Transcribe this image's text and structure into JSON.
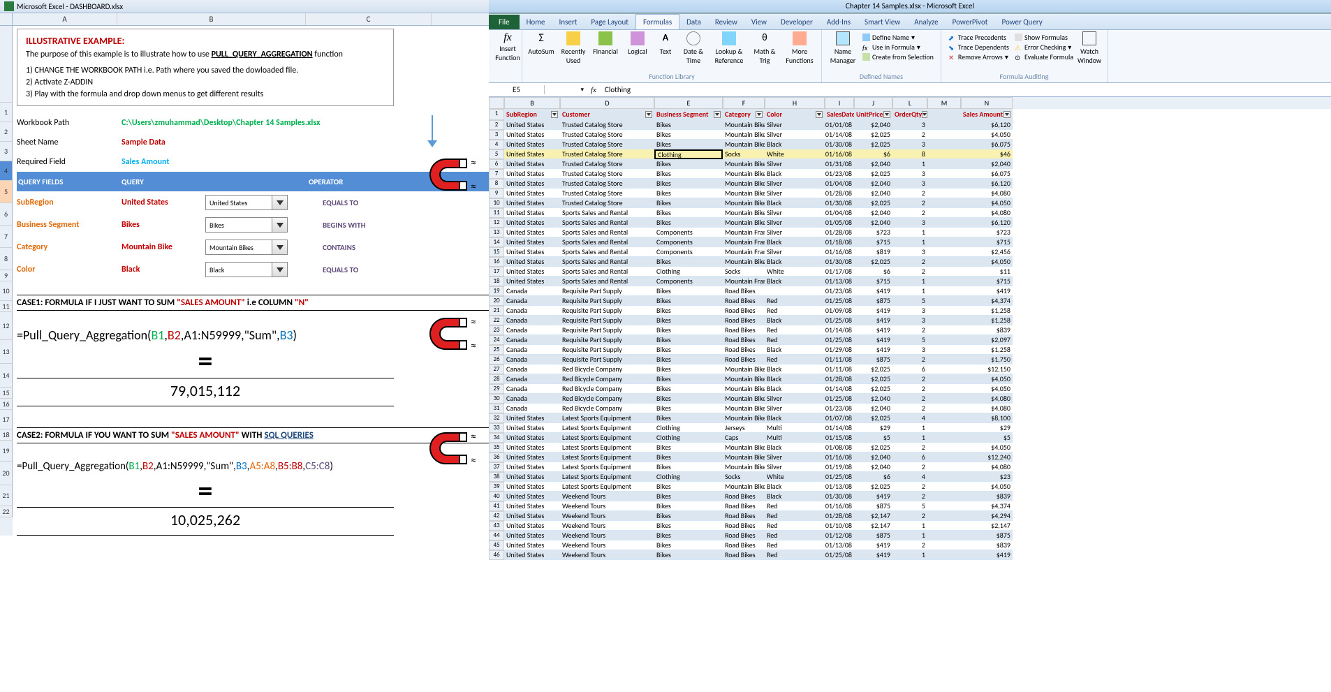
{
  "left": {
    "title": "Microsoft Excel - DASHBOARD.xlsx",
    "cols": [
      "A",
      "B",
      "C"
    ],
    "exTitle": "ILLUSTRATIVE EXAMPLE:",
    "exPurpose1": "The purpose of this example is to illustrate how to use ",
    "exPurpose2": "PULL_QUERY_AGGREGATION",
    "exPurpose3": " function",
    "step1": "1) CHANGE THE WORKBOOK PATH  i.e. Path where you saved the dowloaded file.",
    "step2": "2) Activate Z-ADDIN",
    "step3": "3) Play with the formula and drop down menus to get different results",
    "r1a": "Workbook Path",
    "r1b": "C:\\Users\\zmuhammad\\Desktop\\Chapter 14 Samples.xlsx",
    "r2a": "Sheet Name",
    "r2b": "Sample Data",
    "r3a": "Required Field",
    "r3b": "Sales Amount",
    "hdrA": "QUERY FIELDS",
    "hdrB": "QUERY",
    "hdrC": "OPERATOR",
    "q5a": "SubRegion",
    "q5b": "United States",
    "q5d": "United States",
    "q5op": "EQUALS TO",
    "q6a": "Business Segment",
    "q6b": "Bikes",
    "q6d": "Bikes",
    "q6op": "BEGINS WITH",
    "q7a": "Category",
    "q7b": "Mountain Bike",
    "q7d": "Mountain Bikes",
    "q7op": "CONTAINS",
    "q8a": "Color",
    "q8b": "Black",
    "q8d": "Black",
    "q8op": "EQUALS TO",
    "case1a": "CASE1: FORMULA IF I JUST WANT TO SUM ",
    "case1b": "\"SALES AMOUNT\"",
    "case1c": " i.e COLUMN ",
    "case1d": "\"N\"",
    "formula1_pre": "=Pull_Query_Aggregation(",
    "formula1_b1": "B1",
    "formula1_b2": "B2",
    "formula1_rng": "A1:N59999",
    "formula1_sum": "\"Sum\"",
    "formula1_b3": "B3",
    "eq": "=",
    "result1": "79,015,112",
    "case2a": "CASE2: FORMULA IF YOU WANT TO SUM ",
    "case2b": "\"SALES AMOUNT\"",
    "case2c": " WITH ",
    "case2d": "SQL QUERIES",
    "formula2_pre": "=Pull_Query_Aggregation(",
    "f2_b1": "B1",
    "f2_b2": "B2",
    "f2_rng": "A1:N59999",
    "f2_sum": "\"Sum\"",
    "f2_b3": "B3",
    "f2_a": "A5:A8",
    "f2_bb": "B5:B8",
    "f2_c": "C5:C8",
    "result2": "10,025,262"
  },
  "right": {
    "title": "Chapter 14 Samples.xlsx - Microsoft Excel",
    "tabs": [
      "File",
      "Home",
      "Insert",
      "Page Layout",
      "Formulas",
      "Data",
      "Review",
      "View",
      "Developer",
      "Add-Ins",
      "Smart View",
      "Analyze",
      "PowerPivot",
      "Power Query"
    ],
    "activeTab": 4,
    "groups": {
      "lib": "Function Library",
      "names": "Defined Names",
      "audit": "Formula Auditing"
    },
    "ribbonItems": {
      "insertFn": "Insert Function",
      "autosum": "AutoSum",
      "recent": "Recently Used",
      "financial": "Financial",
      "logical": "Logical",
      "text": "Text",
      "datetime": "Date & Time",
      "lookup": "Lookup & Reference",
      "math": "Math & Trig",
      "more": "More Functions",
      "nameMgr": "Name Manager",
      "defName": "Define Name",
      "useFormula": "Use in Formula",
      "createSel": "Create from Selection",
      "tracePrec": "Trace Precedents",
      "traceDep": "Trace Dependents",
      "removeArr": "Remove Arrows",
      "showForm": "Show Formulas",
      "errCheck": "Error Checking",
      "evalForm": "Evaluate Formula",
      "watch": "Watch Window"
    },
    "activeCell": "E5",
    "formulaValue": "Clothing",
    "colLetters": [
      "B",
      "D",
      "E",
      "F",
      "H",
      "I",
      "J",
      "L",
      "M",
      "N"
    ],
    "headers": [
      "SubRegion",
      "Customer",
      "Business Segment",
      "Category",
      "Color",
      "SalesDate",
      "UnitPrice",
      "OrderQty",
      "",
      "Sales Amount"
    ],
    "data": [
      {
        "n": 2,
        "r": [
          "United States",
          "Trusted Catalog Store",
          "Bikes",
          "Mountain Bikes",
          "Silver",
          "01/01/08",
          "$2,040",
          "3",
          "",
          "$6,120"
        ]
      },
      {
        "n": 3,
        "r": [
          "United States",
          "Trusted Catalog Store",
          "Bikes",
          "Mountain Bikes",
          "Silver",
          "01/14/08",
          "$2,025",
          "2",
          "",
          "$4,050"
        ]
      },
      {
        "n": 4,
        "r": [
          "United States",
          "Trusted Catalog Store",
          "Bikes",
          "Mountain Bikes",
          "Black",
          "01/30/08",
          "$2,025",
          "3",
          "",
          "$6,075"
        ]
      },
      {
        "n": 5,
        "r": [
          "United States",
          "Trusted Catalog Store",
          "Clothing",
          "Socks",
          "White",
          "01/16/08",
          "$6",
          "8",
          "",
          "$46"
        ],
        "hl": true,
        "active": 2
      },
      {
        "n": 6,
        "r": [
          "United States",
          "Trusted Catalog Store",
          "Bikes",
          "Mountain Bikes",
          "Silver",
          "01/31/08",
          "$2,040",
          "1",
          "",
          "$2,040"
        ]
      },
      {
        "n": 7,
        "r": [
          "United States",
          "Trusted Catalog Store",
          "Bikes",
          "Mountain Bikes",
          "Black",
          "01/23/08",
          "$2,025",
          "3",
          "",
          "$6,075"
        ]
      },
      {
        "n": 8,
        "r": [
          "United States",
          "Trusted Catalog Store",
          "Bikes",
          "Mountain Bikes",
          "Silver",
          "01/04/08",
          "$2,040",
          "3",
          "",
          "$6,120"
        ]
      },
      {
        "n": 9,
        "r": [
          "United States",
          "Trusted Catalog Store",
          "Bikes",
          "Mountain Bikes",
          "Silver",
          "01/28/08",
          "$2,040",
          "2",
          "",
          "$4,080"
        ]
      },
      {
        "n": 10,
        "r": [
          "United States",
          "Trusted Catalog Store",
          "Bikes",
          "Mountain Bikes",
          "Black",
          "01/30/08",
          "$2,025",
          "2",
          "",
          "$4,050"
        ]
      },
      {
        "n": 11,
        "r": [
          "United States",
          "Sports Sales and Rental",
          "Bikes",
          "Mountain Bikes",
          "Silver",
          "01/04/08",
          "$2,040",
          "2",
          "",
          "$4,080"
        ]
      },
      {
        "n": 12,
        "r": [
          "United States",
          "Sports Sales and Rental",
          "Bikes",
          "Mountain Bikes",
          "Silver",
          "01/05/08",
          "$2,040",
          "3",
          "",
          "$6,120"
        ]
      },
      {
        "n": 13,
        "r": [
          "United States",
          "Sports Sales and Rental",
          "Components",
          "Mountain Frames",
          "Silver",
          "01/28/08",
          "$723",
          "1",
          "",
          "$723"
        ]
      },
      {
        "n": 14,
        "r": [
          "United States",
          "Sports Sales and Rental",
          "Components",
          "Mountain Frames",
          "Black",
          "01/18/08",
          "$715",
          "1",
          "",
          "$715"
        ]
      },
      {
        "n": 15,
        "r": [
          "United States",
          "Sports Sales and Rental",
          "Components",
          "Mountain Frames",
          "Silver",
          "01/16/08",
          "$819",
          "3",
          "",
          "$2,456"
        ]
      },
      {
        "n": 16,
        "r": [
          "United States",
          "Sports Sales and Rental",
          "Bikes",
          "Mountain Bikes",
          "Black",
          "01/30/08",
          "$2,025",
          "2",
          "",
          "$4,050"
        ]
      },
      {
        "n": 17,
        "r": [
          "United States",
          "Sports Sales and Rental",
          "Clothing",
          "Socks",
          "White",
          "01/17/08",
          "$6",
          "2",
          "",
          "$11"
        ]
      },
      {
        "n": 18,
        "r": [
          "United States",
          "Sports Sales and Rental",
          "Components",
          "Mountain Frames",
          "Black",
          "01/13/08",
          "$715",
          "1",
          "",
          "$715"
        ]
      },
      {
        "n": 19,
        "r": [
          "Canada",
          "Requisite Part Supply",
          "Bikes",
          "Road Bikes",
          "",
          "01/23/08",
          "$419",
          "1",
          "",
          "$419"
        ]
      },
      {
        "n": 20,
        "r": [
          "Canada",
          "Requisite Part Supply",
          "Bikes",
          "Road Bikes",
          "Red",
          "01/25/08",
          "$875",
          "5",
          "",
          "$4,374"
        ]
      },
      {
        "n": 21,
        "r": [
          "Canada",
          "Requisite Part Supply",
          "Bikes",
          "Road Bikes",
          "Red",
          "01/09/08",
          "$419",
          "3",
          "",
          "$1,258"
        ]
      },
      {
        "n": 22,
        "r": [
          "Canada",
          "Requisite Part Supply",
          "Bikes",
          "Road Bikes",
          "Black",
          "01/25/08",
          "$419",
          "3",
          "",
          "$1,258"
        ]
      },
      {
        "n": 23,
        "r": [
          "Canada",
          "Requisite Part Supply",
          "Bikes",
          "Road Bikes",
          "Red",
          "01/14/08",
          "$419",
          "2",
          "",
          "$839"
        ]
      },
      {
        "n": 24,
        "r": [
          "Canada",
          "Requisite Part Supply",
          "Bikes",
          "Road Bikes",
          "Red",
          "01/25/08",
          "$419",
          "5",
          "",
          "$2,097"
        ]
      },
      {
        "n": 25,
        "r": [
          "Canada",
          "Requisite Part Supply",
          "Bikes",
          "Road Bikes",
          "Black",
          "01/29/08",
          "$419",
          "3",
          "",
          "$1,258"
        ]
      },
      {
        "n": 26,
        "r": [
          "Canada",
          "Requisite Part Supply",
          "Bikes",
          "Road Bikes",
          "Red",
          "01/11/08",
          "$875",
          "2",
          "",
          "$1,750"
        ]
      },
      {
        "n": 27,
        "r": [
          "Canada",
          "Red Bicycle Company",
          "Bikes",
          "Mountain Bikes",
          "Black",
          "01/11/08",
          "$2,025",
          "6",
          "",
          "$12,150"
        ]
      },
      {
        "n": 28,
        "r": [
          "Canada",
          "Red Bicycle Company",
          "Bikes",
          "Mountain Bikes",
          "Black",
          "01/28/08",
          "$2,025",
          "2",
          "",
          "$4,050"
        ]
      },
      {
        "n": 29,
        "r": [
          "Canada",
          "Red Bicycle Company",
          "Bikes",
          "Mountain Bikes",
          "Black",
          "01/14/08",
          "$2,025",
          "2",
          "",
          "$4,050"
        ]
      },
      {
        "n": 30,
        "r": [
          "Canada",
          "Red Bicycle Company",
          "Bikes",
          "Mountain Bikes",
          "Silver",
          "01/25/08",
          "$2,040",
          "2",
          "",
          "$4,080"
        ]
      },
      {
        "n": 31,
        "r": [
          "Canada",
          "Red Bicycle Company",
          "Bikes",
          "Mountain Bikes",
          "Silver",
          "01/23/08",
          "$2,040",
          "2",
          "",
          "$4,080"
        ]
      },
      {
        "n": 32,
        "r": [
          "United States",
          "Latest Sports Equipment",
          "Bikes",
          "Mountain Bikes",
          "Black",
          "01/07/08",
          "$2,025",
          "4",
          "",
          "$8,100"
        ]
      },
      {
        "n": 33,
        "r": [
          "United States",
          "Latest Sports Equipment",
          "Clothing",
          "Jerseys",
          "Multi",
          "01/14/08",
          "$29",
          "1",
          "",
          "$29"
        ]
      },
      {
        "n": 34,
        "r": [
          "United States",
          "Latest Sports Equipment",
          "Clothing",
          "Caps",
          "Multi",
          "01/15/08",
          "$5",
          "1",
          "",
          "$5"
        ]
      },
      {
        "n": 35,
        "r": [
          "United States",
          "Latest Sports Equipment",
          "Bikes",
          "Mountain Bikes",
          "Black",
          "01/08/08",
          "$2,025",
          "2",
          "",
          "$4,050"
        ]
      },
      {
        "n": 36,
        "r": [
          "United States",
          "Latest Sports Equipment",
          "Bikes",
          "Mountain Bikes",
          "Silver",
          "01/16/08",
          "$2,040",
          "6",
          "",
          "$12,240"
        ]
      },
      {
        "n": 37,
        "r": [
          "United States",
          "Latest Sports Equipment",
          "Bikes",
          "Mountain Bikes",
          "Silver",
          "01/19/08",
          "$2,040",
          "2",
          "",
          "$4,080"
        ]
      },
      {
        "n": 38,
        "r": [
          "United States",
          "Latest Sports Equipment",
          "Clothing",
          "Socks",
          "White",
          "01/25/08",
          "$6",
          "4",
          "",
          "$23"
        ]
      },
      {
        "n": 39,
        "r": [
          "United States",
          "Latest Sports Equipment",
          "Bikes",
          "Mountain Bikes",
          "Black",
          "01/13/08",
          "$2,025",
          "2",
          "",
          "$4,050"
        ]
      },
      {
        "n": 40,
        "r": [
          "United States",
          "Weekend Tours",
          "Bikes",
          "Road Bikes",
          "Black",
          "01/30/08",
          "$419",
          "2",
          "",
          "$839"
        ]
      },
      {
        "n": 41,
        "r": [
          "United States",
          "Weekend Tours",
          "Bikes",
          "Road Bikes",
          "Red",
          "01/16/08",
          "$875",
          "5",
          "",
          "$4,374"
        ]
      },
      {
        "n": 42,
        "r": [
          "United States",
          "Weekend Tours",
          "Bikes",
          "Road Bikes",
          "Red",
          "01/28/08",
          "$2,147",
          "2",
          "",
          "$4,294"
        ]
      },
      {
        "n": 43,
        "r": [
          "United States",
          "Weekend Tours",
          "Bikes",
          "Road Bikes",
          "Red",
          "01/10/08",
          "$2,147",
          "1",
          "",
          "$2,147"
        ]
      },
      {
        "n": 44,
        "r": [
          "United States",
          "Weekend Tours",
          "Bikes",
          "Road Bikes",
          "Red",
          "01/12/08",
          "$875",
          "1",
          "",
          "$875"
        ]
      },
      {
        "n": 45,
        "r": [
          "United States",
          "Weekend Tours",
          "Bikes",
          "Road Bikes",
          "Red",
          "01/13/08",
          "$419",
          "2",
          "",
          "$839"
        ]
      },
      {
        "n": 46,
        "r": [
          "United States",
          "Weekend Tours",
          "Bikes",
          "Road Bikes",
          "Red",
          "01/25/08",
          "$419",
          "1",
          "",
          "$419"
        ]
      }
    ]
  }
}
